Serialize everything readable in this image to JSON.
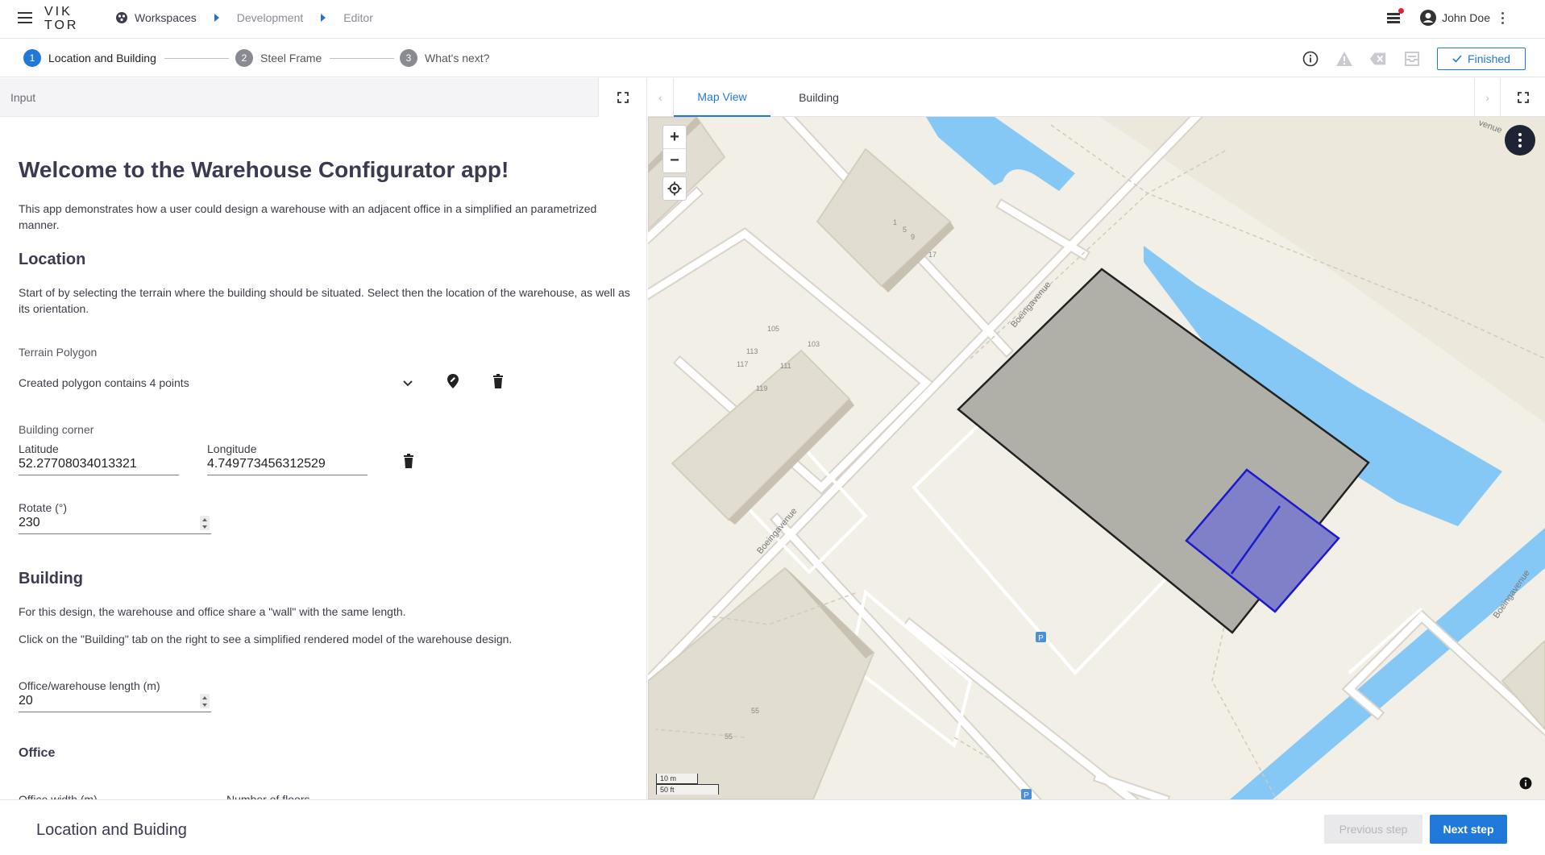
{
  "header": {
    "logo_line1": "VIK",
    "logo_line2": "TOR",
    "breadcrumbs": [
      "Workspaces",
      "Development",
      "Editor"
    ],
    "user_name": "John Doe"
  },
  "stepper": {
    "steps": [
      {
        "num": "1",
        "label": "Location and Building"
      },
      {
        "num": "2",
        "label": "Steel Frame"
      },
      {
        "num": "3",
        "label": "What's next?"
      }
    ],
    "finished_label": "Finished"
  },
  "left_panel": {
    "title": "Input",
    "welcome": "Welcome to the Warehouse Configurator app!",
    "intro": "This app demonstrates how a user could design a warehouse with an adjacent office in a simplified an parametrized manner.",
    "location": {
      "heading": "Location",
      "text": "Start of by selecting the terrain where the building should be situated. Select then the location of the warehouse, as well as its orientation.",
      "terrain_label": "Terrain Polygon",
      "terrain_value": "Created polygon contains 4 points",
      "corner_label": "Building corner",
      "latitude_label": "Latitude",
      "latitude_value": "52.27708034013321",
      "longitude_label": "Longitude",
      "longitude_value": "4.749773456312529",
      "rotate_label": "Rotate (°)",
      "rotate_value": "230"
    },
    "building": {
      "heading": "Building",
      "text1": "For this design, the warehouse and office share a \"wall\" with the same length.",
      "text2": "Click on the \"Building\" tab on the right to see a simplified rendered model of the warehouse design.",
      "length_label": "Office/warehouse length (m)",
      "length_value": "20"
    },
    "office": {
      "heading": "Office",
      "width_label": "Office width (m)",
      "floors_label": "Number of floors"
    }
  },
  "right_panel": {
    "tabs": [
      "Map View",
      "Building"
    ],
    "map": {
      "street_labels": [
        "Boeingavenue",
        "Boeingavenue",
        "Boeingavenue",
        "venue"
      ],
      "house_numbers": [
        "1",
        "5",
        "9",
        "17",
        "105",
        "103",
        "113",
        "117",
        "111",
        "119",
        "55",
        "55"
      ],
      "parking": "P",
      "scale_m": "10 m",
      "scale_ft": "50 ft",
      "zoom_in": "+",
      "zoom_out": "−"
    }
  },
  "footer": {
    "title": "Location and Buiding",
    "prev_label": "Previous step",
    "next_label": "Next step"
  },
  "colors": {
    "accent": "#2079d8",
    "map_bg": "#f2efe6",
    "water": "#86c8f5",
    "terrain_fill": "#b0b0a8",
    "building_fill": "#8080c8",
    "building_stroke": "#1a1acc"
  }
}
